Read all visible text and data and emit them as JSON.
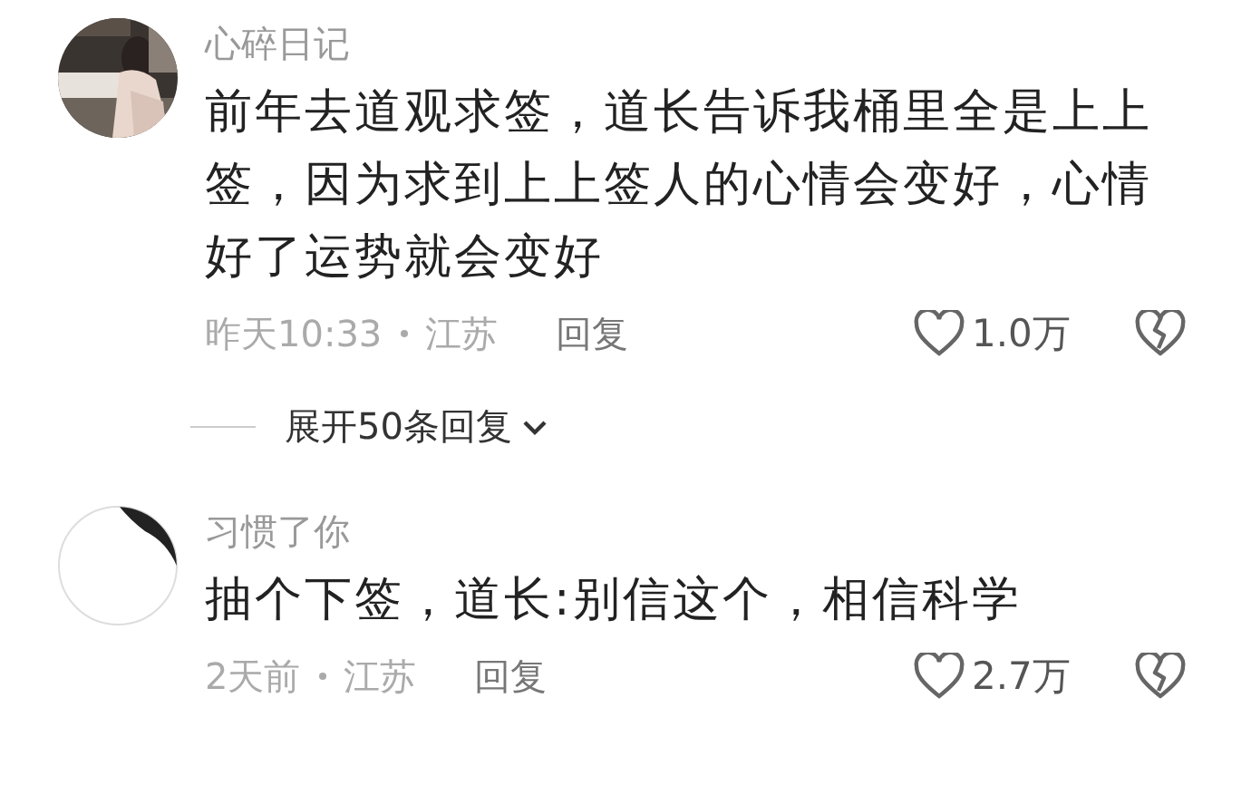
{
  "comments": [
    {
      "username": "心碎日记",
      "text": "前年去道观求签，道长告诉我桶里全是上上签，因为求到上上签人的心情会变好，心情好了运势就会变好",
      "time": "昨天10:33",
      "location": "江苏",
      "reply": "回复",
      "likes": "1.0万",
      "expand": "展开50条回复"
    },
    {
      "username": "习惯了你",
      "avatar": {
        "kind": "drawing"
      },
      "text": "抽个下签，道长:别信这个，相信科学",
      "time": "2天前",
      "location": "江苏",
      "reply": "回复",
      "likes": "2.7万"
    }
  ]
}
